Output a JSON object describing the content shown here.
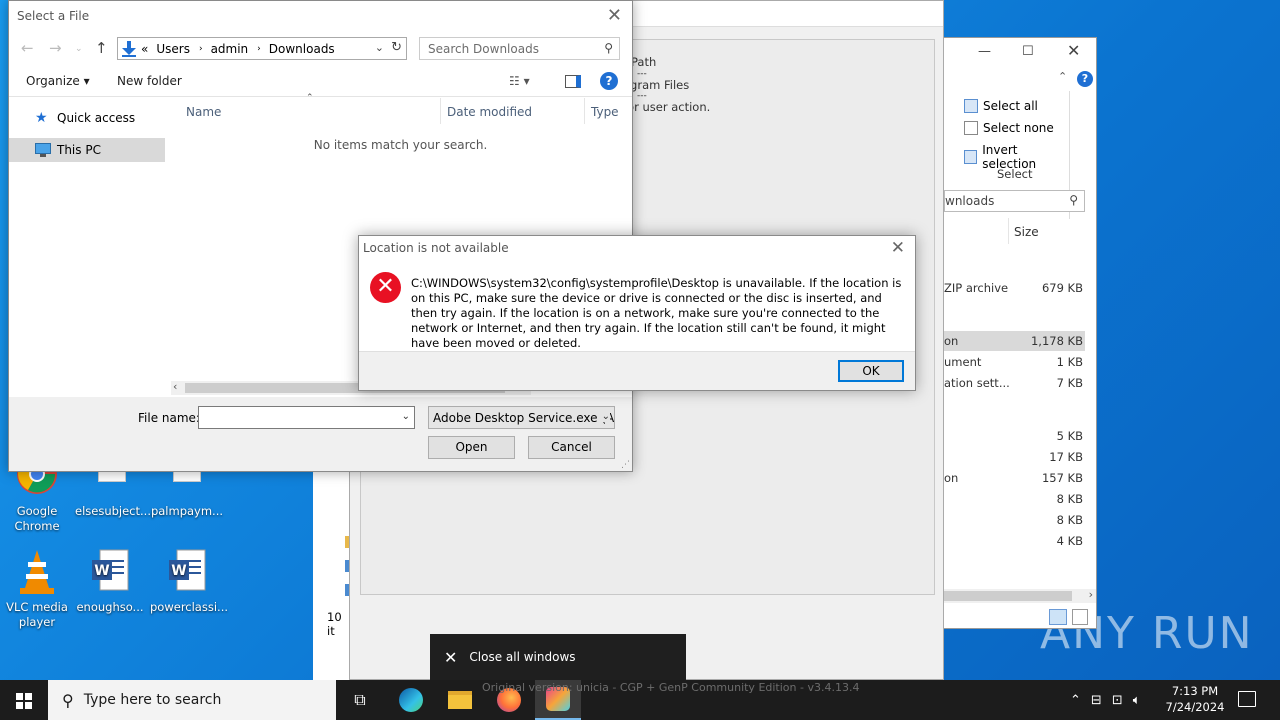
{
  "desktop": {
    "icons": [
      {
        "label": "Google Chrome"
      },
      {
        "label": "elsesubject...."
      },
      {
        "label": "palmpaym..."
      },
      {
        "label": "VLC media player"
      },
      {
        "label": "enoughso..."
      },
      {
        "label": "powerclassi..."
      }
    ],
    "watermark": "ANY RUN"
  },
  "background_window": {
    "info_lines": [
      "Path",
      "---",
      "ogram Files",
      "---",
      "for user action."
    ],
    "item_count": "10 it",
    "status_text": "Original version: unicia - CGP + GenP Community Edition - v3.4.13.4"
  },
  "explorer": {
    "ribbon": {
      "select_all": "Select all",
      "select_none": "Select none",
      "invert_selection": "Invert selection",
      "group_label": "Select"
    },
    "search_text": "wnloads",
    "size_header": "Size",
    "rows": [
      {
        "type": "ZIP archive",
        "size": "679 KB"
      },
      {
        "type": "on",
        "size": "1,178 KB"
      },
      {
        "type": "ument",
        "size": "1 KB"
      },
      {
        "type": "ation sett...",
        "size": "7 KB"
      },
      {
        "type": "",
        "size": "5 KB"
      },
      {
        "type": "",
        "size": "17 KB"
      },
      {
        "type": "on",
        "size": "157 KB"
      },
      {
        "type": "",
        "size": "8 KB"
      },
      {
        "type": "",
        "size": "8 KB"
      },
      {
        "type": "",
        "size": "4 KB"
      }
    ]
  },
  "file_dialog": {
    "title": "Select a File",
    "breadcrumb_prefix": "«",
    "breadcrumbs": [
      "Users",
      "admin",
      "Downloads"
    ],
    "search_placeholder": "Search Downloads",
    "organize_label": "Organize ▾",
    "new_folder_label": "New folder",
    "help_label": "?",
    "nav": {
      "quick_access": "Quick access",
      "this_pc": "This PC"
    },
    "columns": {
      "name": "Name",
      "date_modified": "Date modified",
      "type": "Type"
    },
    "empty_message": "No items match your search.",
    "file_name_label": "File name:",
    "file_name_value": "",
    "filter_value": "Adobe Desktop Service.exe (Ad",
    "open_label": "Open",
    "cancel_label": "Cancel"
  },
  "error_dialog": {
    "title": "Location is not available",
    "message": "C:\\WINDOWS\\system32\\config\\systemprofile\\Desktop is unavailable. If the location is on this PC, make sure the device or drive is connected or the disc is inserted, and then try again. If the location is on a network, make sure you're connected to the network or Internet, and then try again. If the location still can't be found, it might have been moved or deleted.",
    "ok_label": "OK"
  },
  "toast": {
    "label": "Close all windows"
  },
  "taskbar": {
    "search_placeholder": "Type here to search",
    "time": "7:13 PM",
    "date": "7/24/2024"
  },
  "colors": {
    "accent": "#0078d7",
    "error": "#e81123",
    "desktop": "#1493e6",
    "taskbar": "#1c1c1c"
  }
}
